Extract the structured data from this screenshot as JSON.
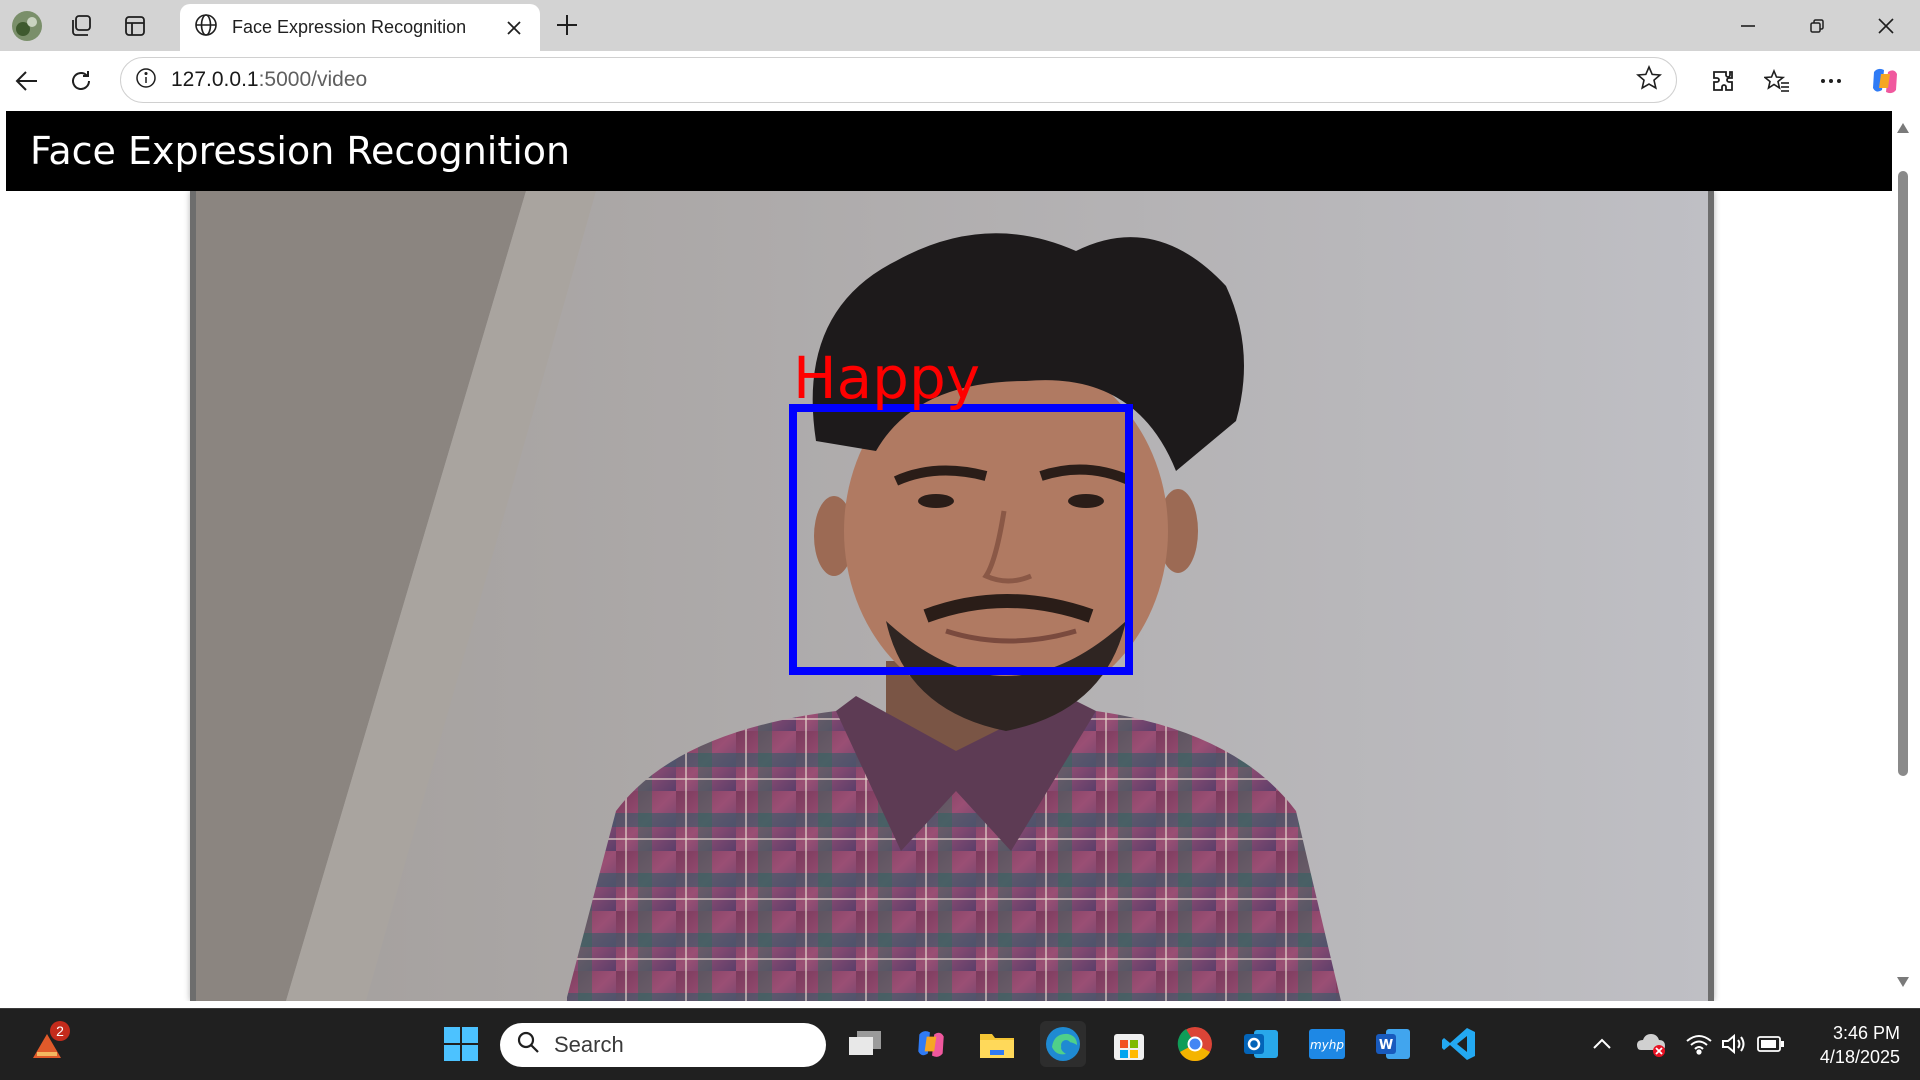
{
  "browser": {
    "tab_title": "Face Expression Recognition",
    "url_host": "127.0.0.1",
    "url_path": ":5000/video"
  },
  "page": {
    "header_title": "Face Expression Recognition"
  },
  "video": {
    "emotion_label": "Happy",
    "label_color": "#ff0000",
    "box_color": "#0000ff"
  },
  "taskbar": {
    "search_placeholder": "Search",
    "time": "3:46 PM",
    "date": "4/18/2025",
    "notification_count": "2"
  },
  "colors": {
    "header_bg": "#000000",
    "tabstrip_bg": "#d3d3d3",
    "taskbar_bg": "#202020"
  }
}
